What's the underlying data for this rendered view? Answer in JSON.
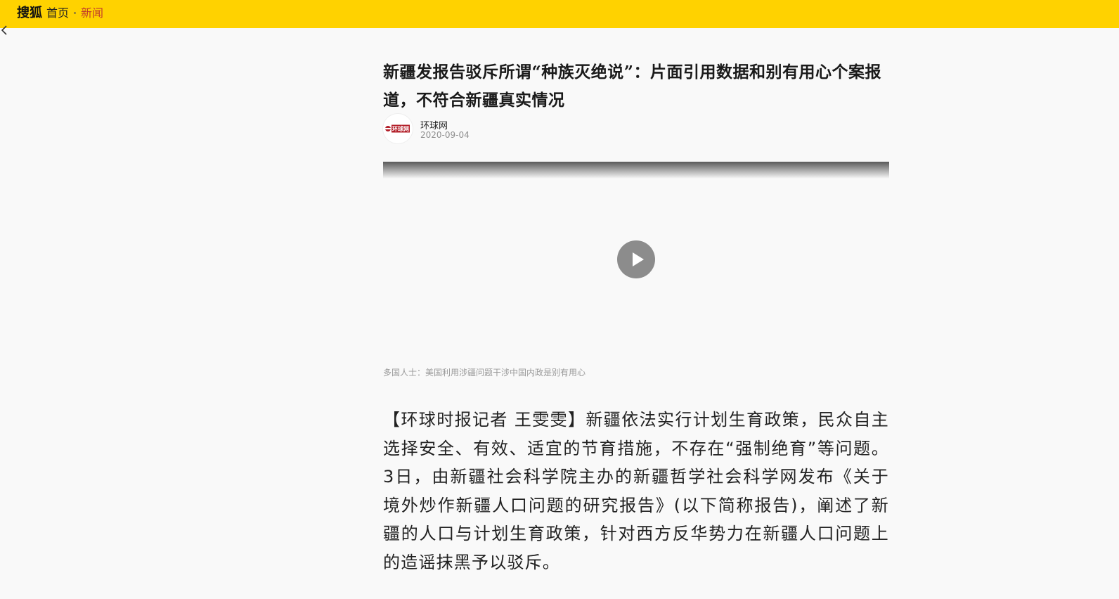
{
  "header": {
    "brand": "搜狐",
    "home_label": "首页",
    "separator": "·",
    "section_label": "新闻",
    "bg_color": "#ffd200",
    "section_color": "#c0392b"
  },
  "nav": {
    "back_icon": "chevron-left-icon"
  },
  "article": {
    "title": "新疆发报告驳斥所谓“种族灭绝说”：片面引用数据和别有用心个案报道，不符合新疆真实情况",
    "author": {
      "name": "环球网",
      "date": "2020-09-04",
      "logo_text": "环球网"
    },
    "video": {
      "play_icon": "play-icon",
      "caption": "多国人士：美国利用涉疆问题干涉中国内政是别有用心"
    },
    "paragraph": "【环球时报记者 王雯雯】新疆依法实行计划生育政策，民众自主选择安全、有效、适宜的节育措施，不存在“强制绝育”等问题。3日，由新疆社会科学院主办的新疆哲学社会科学网发布《关于境外炒作新疆人口问题的研究报告》(以下简称报告)，阐述了新疆的人口与计划生育政策，针对西方反华势力在新疆人口问题上的造谣抹黑予以驳斥。"
  }
}
